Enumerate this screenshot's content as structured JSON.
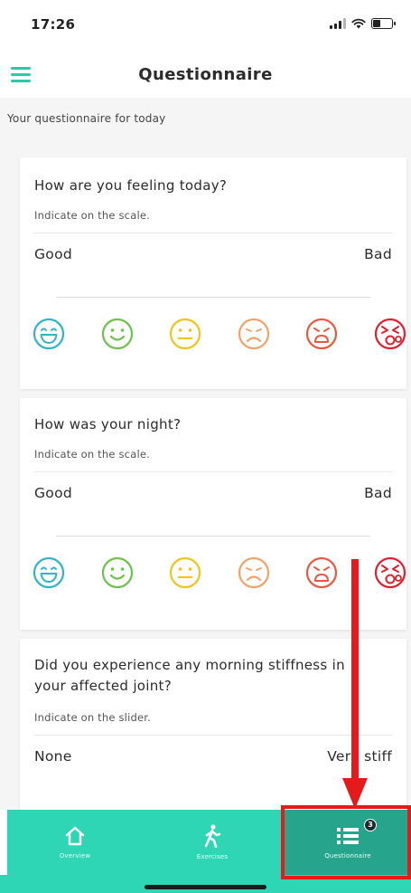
{
  "status_bar": {
    "time": "17:26",
    "battery_level": 0.4
  },
  "header": {
    "title": "Questionnaire",
    "menu_icon": "hamburger-menu-icon"
  },
  "intro": "Your questionnaire for today",
  "colors": {
    "accent": "#2fc7a8",
    "tab_bar": "#2fd6b5",
    "tab_active": "#26a48c",
    "annotation_red": "#e31b1b",
    "face_colors": [
      "#2fb5c9",
      "#6cc24a",
      "#f0c419",
      "#f0a36a",
      "#e8593f",
      "#e0202e"
    ]
  },
  "questions": [
    {
      "question": "How are you feeling today?",
      "hint": "Indicate on the scale.",
      "low_label": "Good",
      "high_label": "Bad",
      "faces": [
        "very-happy-face-icon",
        "happy-face-icon",
        "neutral-face-icon",
        "sad-face-icon",
        "upset-face-icon",
        "very-upset-face-icon"
      ]
    },
    {
      "question": "How was your night?",
      "hint": "Indicate on the scale.",
      "low_label": "Good",
      "high_label": "Bad",
      "faces": [
        "very-happy-face-icon",
        "happy-face-icon",
        "neutral-face-icon",
        "sad-face-icon",
        "upset-face-icon",
        "very-upset-face-icon"
      ]
    },
    {
      "question": "Did you experience any morning stiffness in your affected joint?",
      "hint": "Indicate on the slider.",
      "low_label": "None",
      "high_label": "Very stiff"
    }
  ],
  "tab_bar": {
    "tabs": [
      {
        "label": "Overview",
        "icon": "home-icon"
      },
      {
        "label": "Exercises",
        "icon": "walking-person-icon"
      },
      {
        "label": "Questionnaire",
        "icon": "list-icon",
        "badge": "3",
        "active": true
      }
    ]
  }
}
